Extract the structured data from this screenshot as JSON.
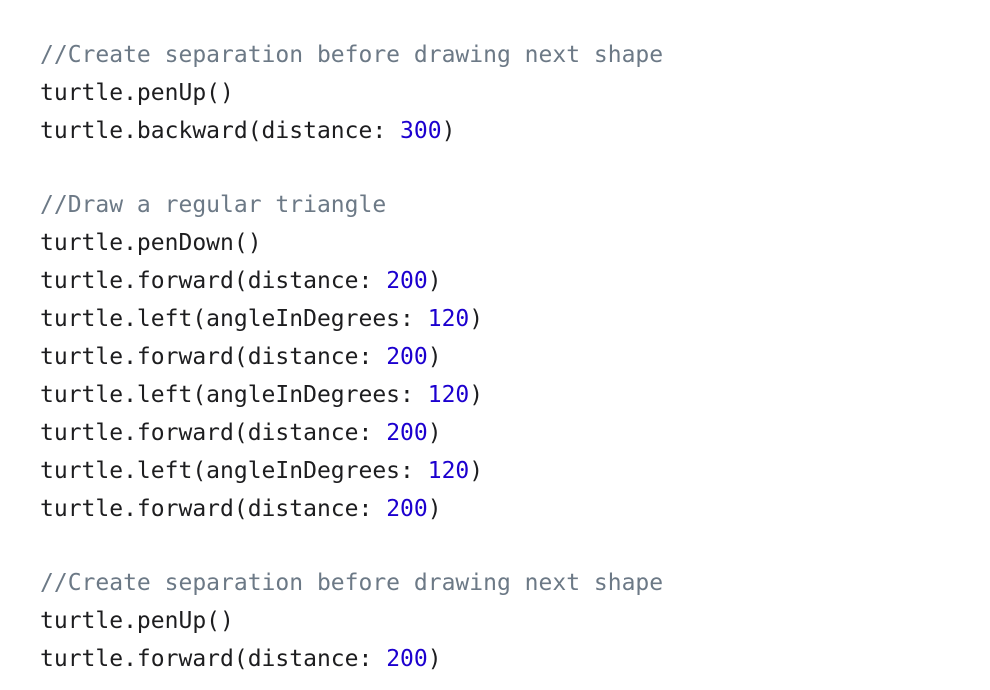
{
  "colors": {
    "background": "#ffffff",
    "plain_text": "#1d1d1f",
    "comment": "#6c7986",
    "number_literal": "#1c00cf"
  },
  "code": {
    "lines": [
      {
        "kind": "comment",
        "text": "//Create separation before drawing next shape"
      },
      {
        "kind": "code",
        "text": "turtle.penUp()"
      },
      {
        "kind": "call",
        "prefix": "turtle.backward(distance: ",
        "number": "300",
        "suffix": ")"
      },
      {
        "kind": "blank"
      },
      {
        "kind": "comment",
        "text": "//Draw a regular triangle"
      },
      {
        "kind": "code",
        "text": "turtle.penDown()"
      },
      {
        "kind": "call",
        "prefix": "turtle.forward(distance: ",
        "number": "200",
        "suffix": ")"
      },
      {
        "kind": "call",
        "prefix": "turtle.left(angleInDegrees: ",
        "number": "120",
        "suffix": ")"
      },
      {
        "kind": "call",
        "prefix": "turtle.forward(distance: ",
        "number": "200",
        "suffix": ")"
      },
      {
        "kind": "call",
        "prefix": "turtle.left(angleInDegrees: ",
        "number": "120",
        "suffix": ")"
      },
      {
        "kind": "call",
        "prefix": "turtle.forward(distance: ",
        "number": "200",
        "suffix": ")"
      },
      {
        "kind": "call",
        "prefix": "turtle.left(angleInDegrees: ",
        "number": "120",
        "suffix": ")"
      },
      {
        "kind": "call",
        "prefix": "turtle.forward(distance: ",
        "number": "200",
        "suffix": ")"
      },
      {
        "kind": "blank"
      },
      {
        "kind": "comment",
        "text": "//Create separation before drawing next shape"
      },
      {
        "kind": "code",
        "text": "turtle.penUp()"
      },
      {
        "kind": "call",
        "prefix": "turtle.forward(distance: ",
        "number": "200",
        "suffix": ")"
      }
    ]
  }
}
